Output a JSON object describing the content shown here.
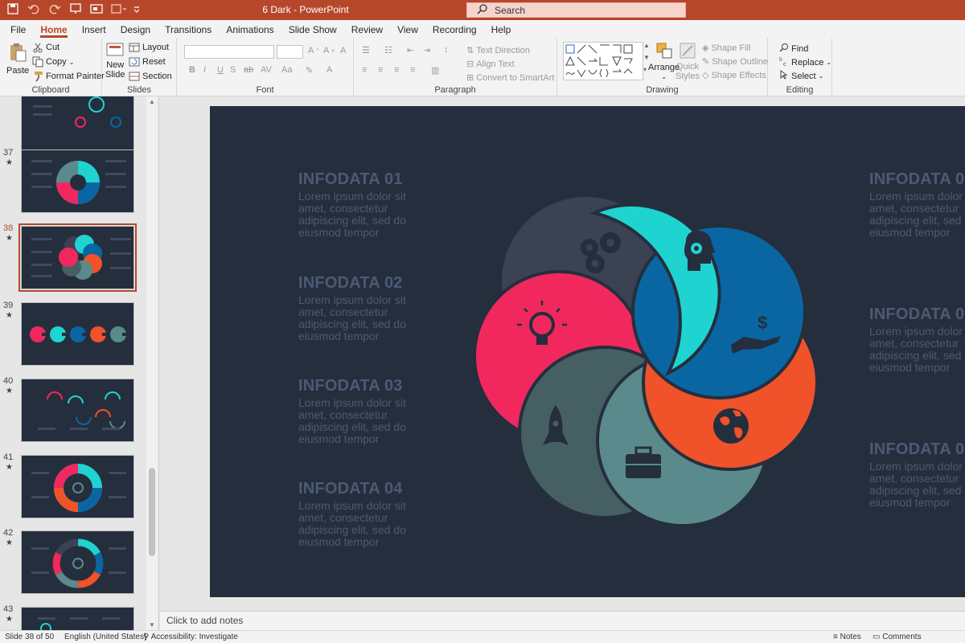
{
  "window": {
    "doc_title": "6 Dark  -  PowerPoint",
    "search_placeholder": "Search"
  },
  "tabs": [
    "File",
    "Home",
    "Insert",
    "Design",
    "Transitions",
    "Animations",
    "Slide Show",
    "Review",
    "View",
    "Recording",
    "Help"
  ],
  "active_tab": "Home",
  "ribbon": {
    "clipboard": {
      "label": "Clipboard",
      "paste": "Paste",
      "cut": "Cut",
      "copy": "Copy",
      "format_painter": "Format Painter"
    },
    "slides": {
      "label": "Slides",
      "new_slide_1": "New",
      "new_slide_2": "Slide",
      "layout": "Layout",
      "reset": "Reset",
      "section": "Section"
    },
    "font": {
      "label": "Font"
    },
    "paragraph": {
      "label": "Paragraph",
      "text_direction": "Text Direction",
      "align_text": "Align Text",
      "convert_smartart": "Convert to SmartArt"
    },
    "drawing": {
      "label": "Drawing",
      "arrange": "Arrange",
      "quick_styles_1": "Quick",
      "quick_styles_2": "Styles",
      "shape_fill": "Shape Fill",
      "shape_outline": "Shape Outline",
      "shape_effects": "Shape Effects"
    },
    "editing": {
      "label": "Editing",
      "find": "Find",
      "replace": "Replace",
      "select": "Select"
    }
  },
  "slides_panel": {
    "thumbs": [
      {
        "num": "",
        "star": ""
      },
      {
        "num": "37",
        "star": "★"
      },
      {
        "num": "38",
        "star": "★"
      },
      {
        "num": "39",
        "star": "★"
      },
      {
        "num": "40",
        "star": "★"
      },
      {
        "num": "41",
        "star": "★"
      },
      {
        "num": "42",
        "star": "★"
      },
      {
        "num": "43",
        "star": "★"
      }
    ],
    "selected": "38"
  },
  "slide": {
    "left_items": [
      {
        "title": "INFODATA 01",
        "body": "Lorem ipsum dolor sit amet, consectetur adipiscing elit, sed do eiusmod tempor"
      },
      {
        "title": "INFODATA 02",
        "body": "Lorem ipsum dolor sit amet, consectetur adipiscing elit, sed do eiusmod tempor"
      },
      {
        "title": "INFODATA 03",
        "body": "Lorem ipsum dolor sit amet, consectetur adipiscing elit, sed do eiusmod tempor"
      },
      {
        "title": "INFODATA 04",
        "body": "Lorem ipsum dolor sit amet, consectetur adipiscing elit, sed do eiusmod tempor"
      }
    ],
    "right_items": [
      {
        "title": "INFODATA 0",
        "body": "Lorem ipsum dolor sit amet, consectetur adipiscing elit, sed do eiusmod tempor"
      },
      {
        "title": "INFODATA 0",
        "body": "Lorem ipsum dolor sit amet, consectetur adipiscing elit, sed do eiusmod tempor"
      },
      {
        "title": "INFODATA 0",
        "body": "Lorem ipsum dolor sit amet, consectetur adipiscing elit, sed do eiusmod tempor"
      }
    ],
    "petal_colors": {
      "teal": "#1fd3d1",
      "blue": "#0a66a3",
      "orange": "#f0522a",
      "slate": "#5a8a8b",
      "darkslate": "#465f62",
      "pink": "#f0285d",
      "gray": "#3a4253"
    },
    "icons": [
      "gears-icon",
      "head-gear-icon",
      "dollar-hand-icon",
      "globe-icon",
      "briefcase-icon",
      "rocket-icon",
      "lightbulb-icon"
    ]
  },
  "notes": {
    "placeholder": "Click to add notes"
  },
  "status": {
    "slide_of": "Slide 38 of 50",
    "language": "English (United States)",
    "accessibility": "Accessibility: Investigate",
    "notes": "Notes",
    "comments": "Comments"
  },
  "colors": {
    "accent": "#b7472a",
    "slide_bg": "#252e3d",
    "text_muted": "#4c5a74"
  }
}
